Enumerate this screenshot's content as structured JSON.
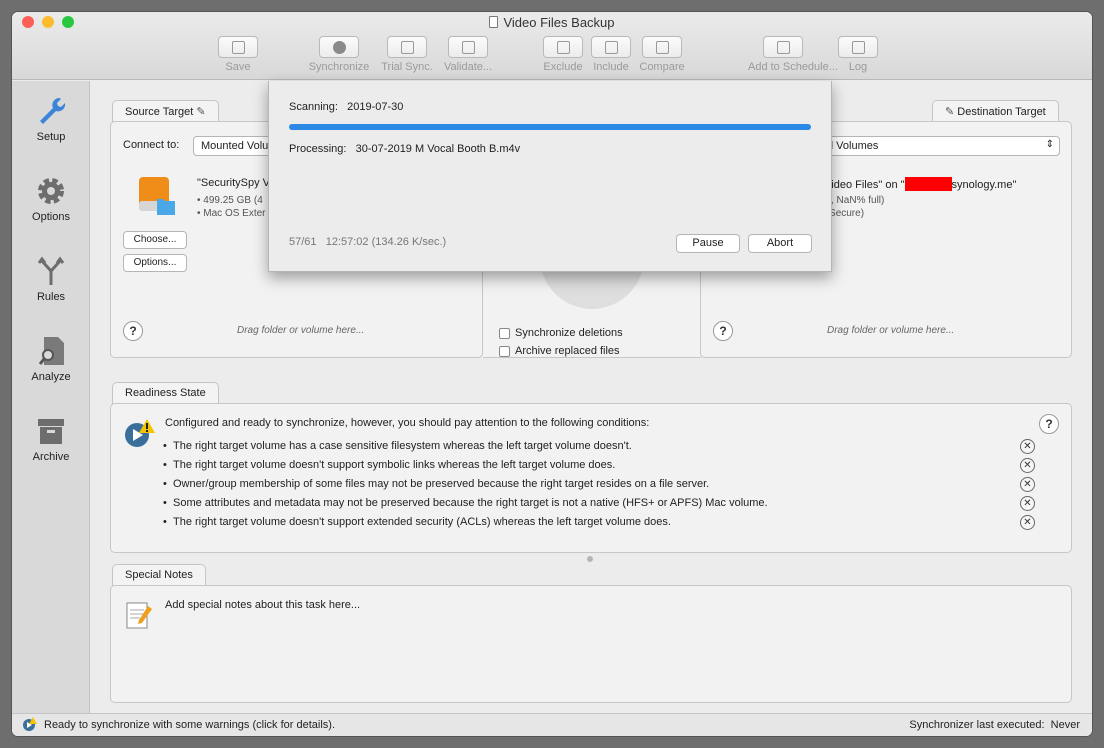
{
  "window": {
    "title": "Video Files Backup"
  },
  "toolbar": {
    "save": "Save",
    "synchronize": "Synchronize",
    "trial_sync": "Trial Sync.",
    "validate": "Validate...",
    "exclude": "Exclude",
    "include": "Include",
    "compare": "Compare",
    "add_to_schedule": "Add to Schedule...",
    "log": "Log"
  },
  "sidebar": {
    "items": [
      {
        "label": "Setup",
        "icon": "wrench-icon"
      },
      {
        "label": "Options",
        "icon": "gear-icon"
      },
      {
        "label": "Rules",
        "icon": "rules-icon"
      },
      {
        "label": "Analyze",
        "icon": "analyze-icon"
      },
      {
        "label": "Archive",
        "icon": "archive-icon"
      }
    ]
  },
  "source": {
    "tab": "Source Target",
    "connect_label": "Connect to:",
    "connect_value": "Mounted Volu",
    "volume_name": "\"SecuritySpy V",
    "size": "• 499.25 GB (4",
    "format": "• Mac OS Exter",
    "choose_button": "Choose...",
    "options_button": "Options...",
    "drag_hint": "Drag folder or volume here..."
  },
  "destination": {
    "tab": "Destination Target",
    "connect_value": "d Volumes",
    "volume_name_prefix": "' Video Files\" on \"",
    "volume_name_suffix": "synology.me\"",
    "size": "ail, NaN% full)",
    "security": "' (Secure)",
    "drag_hint": "Drag folder or volume here..."
  },
  "middle": {
    "sync_deletions": "Synchronize deletions",
    "archive_replaced": "Archive replaced files"
  },
  "readiness": {
    "tab": "Readiness State",
    "headline": "Configured and ready to synchronize, however, you should pay attention to the following conditions:",
    "conditions": [
      "The right target volume has a case sensitive filesystem whereas the left target volume doesn't.",
      "The right target volume doesn't support symbolic links whereas the left target volume does.",
      "Owner/group membership of some files may not be preserved because the right target resides on a file server.",
      "Some attributes and metadata may not be preserved because the right target is not a native (HFS+ or APFS) Mac volume.",
      "The right target volume doesn't support extended security (ACLs) whereas the left target volume does."
    ]
  },
  "notes": {
    "tab": "Special Notes",
    "placeholder": "Add special notes about this task here..."
  },
  "progress": {
    "scanning_label": "Scanning:",
    "scanning_value": "2019-07-30",
    "processing_label": "Processing:",
    "processing_value": "30-07-2019 M Vocal Booth B.m4v",
    "count": "57/61",
    "stats": "12:57:02 (134.26 K/sec.)",
    "fraction": 0.934,
    "pause_button": "Pause",
    "abort_button": "Abort"
  },
  "status": {
    "message": "Ready to synchronize with some warnings (click for details).",
    "last_executed_label": "Synchronizer last executed:",
    "last_executed_value": "Never"
  },
  "colors": {
    "accent": "#2b8ae6",
    "redaction": "#ff0000",
    "warning": "#f5c400",
    "folder": "#4aa8e8"
  }
}
